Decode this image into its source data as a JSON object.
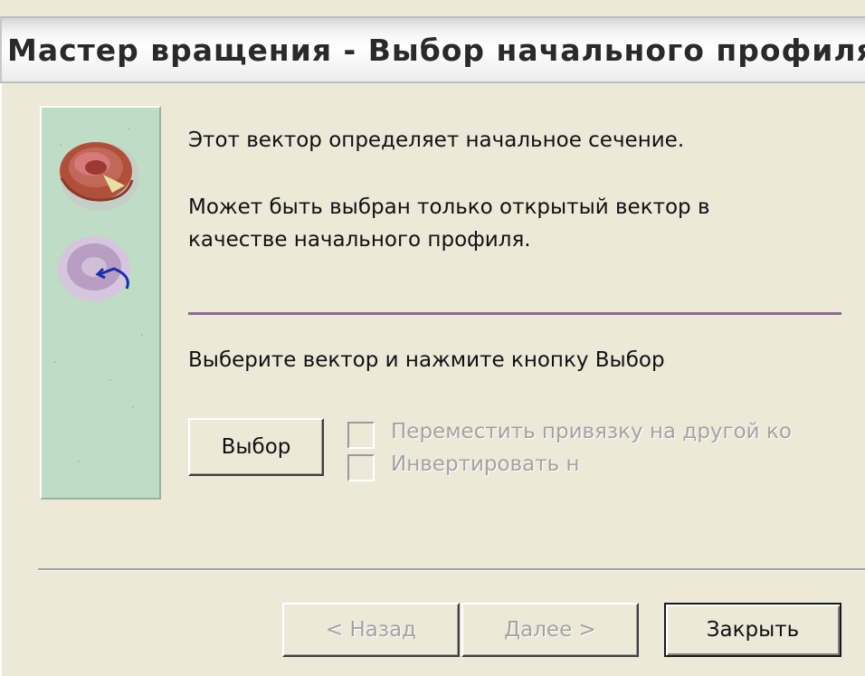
{
  "window": {
    "title": "Мастер вращения - Выбор начального профиля"
  },
  "side_panel": {
    "icons": [
      "torus-solid-icon",
      "torus-revolve-icon"
    ]
  },
  "content": {
    "info_line1": "Этот вектор определяет начальное сечение.",
    "info_line2a": "Может быть выбран только открытый вектор в",
    "info_line2b": "качестве начального профиля.",
    "instruction": "Выберите вектор и нажмите кнопку Выбор",
    "select_button": "Выбор",
    "checkbox_move_snap": {
      "label": "Переместить привязку на другой ко",
      "checked": false,
      "enabled": false
    },
    "checkbox_invert": {
      "label": "Инвертировать н",
      "checked": false,
      "enabled": false
    }
  },
  "footer": {
    "back_button": "< Назад",
    "next_button": "Далее >",
    "close_button": "Закрыть"
  },
  "colors": {
    "dialog_bg": "#ece9d8",
    "side_panel_bg": "#bfdcc4",
    "accent_line": "#8d6c8e"
  }
}
